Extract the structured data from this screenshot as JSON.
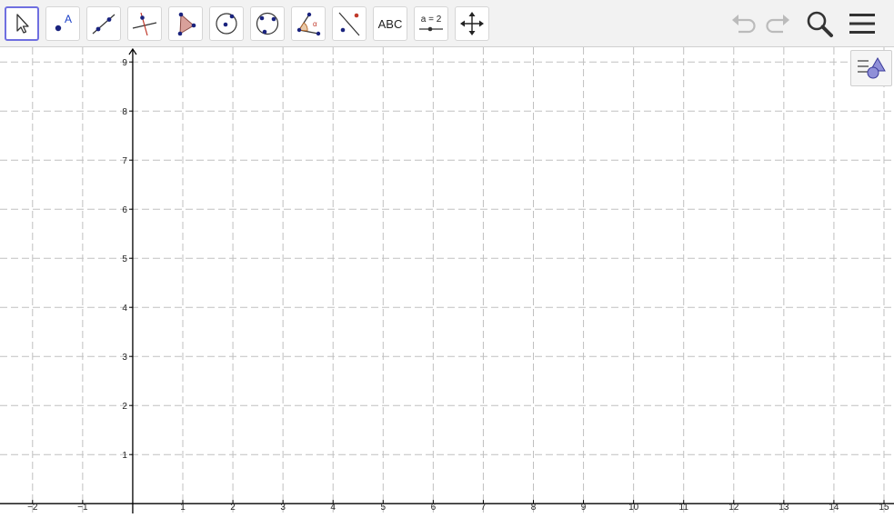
{
  "toolbar": {
    "tools": [
      {
        "name": "move",
        "active": true
      },
      {
        "name": "point",
        "label": "A"
      },
      {
        "name": "line"
      },
      {
        "name": "perpendicular-line"
      },
      {
        "name": "polygon"
      },
      {
        "name": "circle-center-point"
      },
      {
        "name": "circle-three-points"
      },
      {
        "name": "angle",
        "label": "α"
      },
      {
        "name": "reflect-about-line"
      },
      {
        "name": "text",
        "label": "ABC"
      },
      {
        "name": "slider",
        "label": "a = 2"
      },
      {
        "name": "move-graphics-view"
      }
    ],
    "right": [
      "undo-icon",
      "redo-icon",
      "search-icon",
      "menu-icon"
    ]
  },
  "graphics": {
    "x_tick_labels": [
      "−2",
      "−1",
      "1",
      "2",
      "3",
      "4",
      "5",
      "6",
      "7",
      "8",
      "9",
      "10",
      "11",
      "12",
      "13",
      "14",
      "15"
    ],
    "y_tick_labels": [
      "1",
      "2",
      "3",
      "4",
      "5",
      "6",
      "7",
      "8",
      "9"
    ],
    "x_range": [
      -2.65,
      15.2
    ],
    "y_range": [
      -0.2,
      9.3
    ],
    "grid": true
  },
  "style_bar_icon": "graphics-style-icon",
  "colors": {
    "toolbar_bg": "#f2f2f2",
    "active_border": "#6f6fe0",
    "point": "#1a237e",
    "line_red": "#c0392b",
    "polygon_fill": "#d9a09a",
    "grid": "#c0c0c0",
    "axis": "#000000",
    "disabled": "#bbbbbb"
  }
}
